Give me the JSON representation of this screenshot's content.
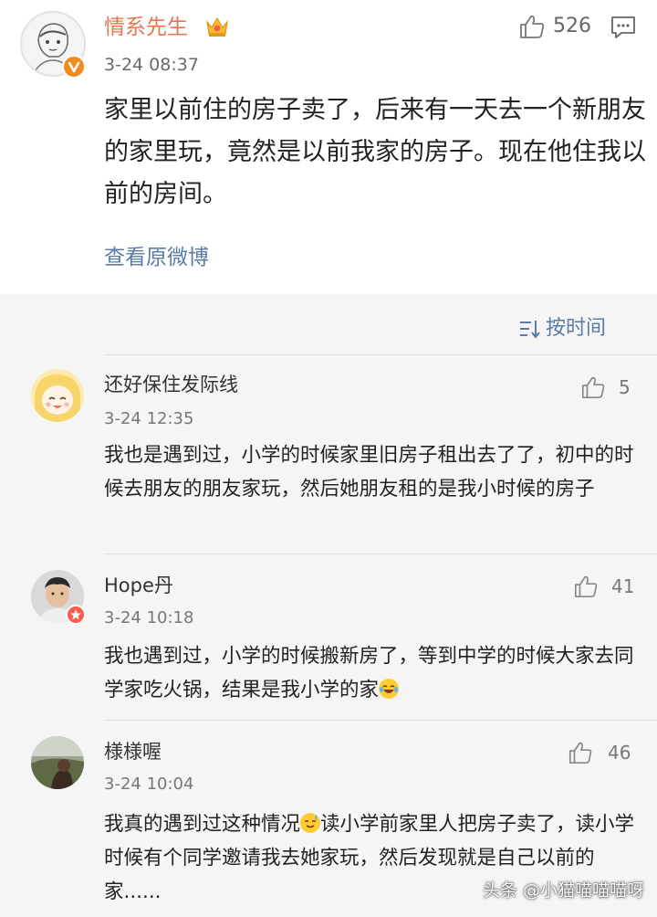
{
  "post": {
    "author": "情系先生",
    "time": "3-24 08:37",
    "like_count": "526",
    "text": "家里以前住的房子卖了，后来有一天去一个新朋友的家里玩，竟然是以前我家的房子。现在他住我以前的房间。",
    "view_original": "查看原微博"
  },
  "sort": {
    "label": "按时间"
  },
  "comments": [
    {
      "author": "还好保住发际线",
      "time": "3-24 12:35",
      "likes": "5",
      "text": "我也是遇到过，小学的时候家里旧房子租出去了了，初中的时候去朋友的朋友家玩，然后她朋友租的是我小时候的房子"
    },
    {
      "author": "Hope丹",
      "time": "3-24 10:18",
      "likes": "41",
      "text": "我也遇到过，小学的时候搬新房了，等到中学的时候大家去同学家吃火锅，结果是我小学的家"
    },
    {
      "author": "様様喔",
      "time": "3-24 10:04",
      "likes": "46",
      "text_part1": "我真的遇到过这种情况",
      "text_part2": "读小学前家里人把房子卖了，读小学时候有个同学邀请我去她家玩，然后发现就是自己以前的家......"
    }
  ],
  "watermark": "头条 @小猫喵喵喵呀",
  "colors": {
    "author_orange": "#eb7350",
    "link_blue": "#5a7ca6",
    "verified_orange": "#f08a1c",
    "background_gray": "#f5f5f5"
  },
  "icons": {
    "like": "thumbs-up-icon",
    "comment": "comment-bubble-icon",
    "sort": "sort-lines-icon",
    "crown": "crown-member-icon",
    "verified": "verified-badge-icon",
    "emoji_laugh": "laughing-crying-emoji",
    "emoji_sweat": "sweat-smile-emoji"
  }
}
